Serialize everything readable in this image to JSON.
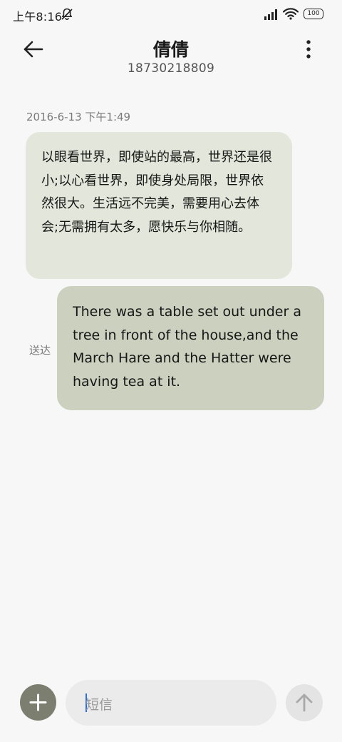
{
  "status_bar": {
    "time": "上午8:16",
    "mute_icon": "bell-off-icon",
    "signal_icon": "signal-bars-icon",
    "wifi_icon": "wifi-icon",
    "battery": "100"
  },
  "header": {
    "back_icon": "arrow-left-icon",
    "contact_name": "倩倩",
    "phone_number": "18730218809",
    "more_icon": "more-vertical-icon"
  },
  "conversation": {
    "timestamp": "2016-6-13 下午1:49",
    "incoming_message": {
      "text": "以眼看世界，即使站的最高，世界还是很小;以心看世界，即使身处局限，世界依然很大。生活远不完美，需要用心去体会;无需拥有太多，愿快乐与你相随。"
    },
    "outgoing_message": {
      "text": "There was a table set out under a tree in front of the house,and the March Hare and the Hatter were having tea at it.",
      "status": "送达"
    }
  },
  "composer": {
    "add_icon": "plus-icon",
    "placeholder": "短信",
    "send_icon": "arrow-up-icon"
  },
  "colors": {
    "background": "#f7f7f7",
    "incoming_bubble": "#e3e6da",
    "outgoing_bubble": "#ccd0be",
    "add_button": "#7c7f6f",
    "caret": "#2f6fd8"
  }
}
